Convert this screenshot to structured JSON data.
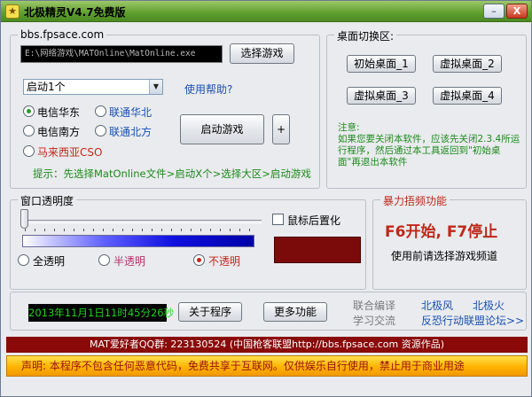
{
  "window": {
    "title": "北极精灵V4.7免费版",
    "minimize_glyph": "–",
    "close_glyph": "X"
  },
  "launcher": {
    "site": "bbs.fpsace.com",
    "path_value": "E:\\网络游戏\\MATOnline\\MatOnline.exe",
    "choose_game_label": "选择游戏",
    "dropdown_value": "启动1个",
    "help_link": "使用帮助?",
    "servers": [
      {
        "label": "电信华东",
        "selected": true
      },
      {
        "label": "联通华北",
        "selected": false
      },
      {
        "label": "电信南方",
        "selected": false
      },
      {
        "label": "联通北方",
        "selected": false
      },
      {
        "label": "马来西亚CSO",
        "selected": false
      }
    ],
    "launch_label": "启动游戏",
    "plus_label": "+",
    "hint": "提示：先选择MatOnline文件>启动X个>选择大区>启动游戏"
  },
  "desktop": {
    "legend": "桌面切换区:",
    "buttons": [
      "初始桌面_1",
      "虚拟桌面_2",
      "虚拟桌面_3",
      "虚拟桌面_4"
    ],
    "note_title": "注意:",
    "note_body": "如果您要关闭本软件，应该先关闭2.3.4所运行程序，然后通过本工具返回到\"初始桌面\"再退出本软件"
  },
  "transparency": {
    "legend": "窗口透明度",
    "mouse_top_label": "鼠标后置化",
    "options": [
      {
        "label": "全透明",
        "selected": false
      },
      {
        "label": "半透明",
        "selected": false
      },
      {
        "label": "不透明",
        "selected": true
      }
    ],
    "slider_value": 0
  },
  "violence": {
    "legend": "暴力捂频功能",
    "hotkeys": "F6开始, F7停止",
    "hint": "使用前请选择游戏频道"
  },
  "footer": {
    "clock": "2013年11月1日11时45分26秒",
    "about_label": "关于程序",
    "more_label": "更多功能",
    "joint_label": "联合编译",
    "study_label": "学习交流",
    "author1": "北极风",
    "author2": "北极火",
    "forum_link": "反恐行动联盟论坛>>"
  },
  "status": {
    "credits": "MAT爱好者QQ群: 223130524  (中国枪客联盟http://bbs.fpsace.com 资源作品)",
    "notice": "声明: 本程序不包含任何恶意代码，免费共享于互联网。仅供娱乐自行使用，禁止用于商业用途"
  },
  "colors": {
    "title_green": "#5e9e2e",
    "status_red": "#8a0a0a",
    "notice_yellow": "#ffb300",
    "clock_green": "#21d121",
    "color_swatch": "#7b0a0a"
  }
}
